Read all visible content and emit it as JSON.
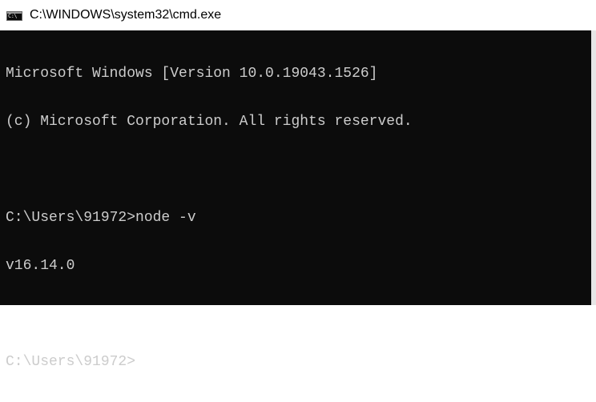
{
  "window": {
    "title": "C:\\WINDOWS\\system32\\cmd.exe",
    "icon": "cmd-console-icon",
    "icon_text": "C:\\"
  },
  "console": {
    "background": "#0c0c0c",
    "foreground": "#cccccc",
    "lines": [
      "Microsoft Windows [Version 10.0.19043.1526]",
      "(c) Microsoft Corporation. All rights reserved.",
      "",
      "C:\\Users\\91972>node -v",
      "v16.14.0",
      "",
      "C:\\Users\\91972>"
    ]
  }
}
